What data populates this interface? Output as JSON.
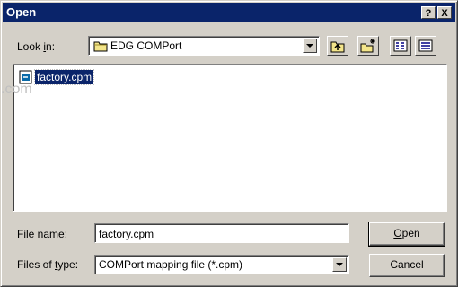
{
  "window": {
    "title": "Open",
    "help_glyph": "?",
    "close_glyph": "X"
  },
  "look_in": {
    "label_pre": "Look ",
    "label_key": "i",
    "label_post": "n:",
    "value": "EDG COMPort",
    "icon": "folder-icon"
  },
  "toolbar": {
    "buttons": [
      {
        "name": "up-one-level-icon"
      },
      {
        "name": "new-folder-icon"
      },
      {
        "name": "list-view-icon"
      },
      {
        "name": "details-view-icon"
      }
    ]
  },
  "files": [
    {
      "name": "factory.cpm",
      "icon": "cpm-file-icon",
      "selected": true
    }
  ],
  "watermark": ".com",
  "file_name": {
    "label_pre": "File ",
    "label_key": "n",
    "label_post": "ame:",
    "value": "factory.cpm"
  },
  "file_type": {
    "label_pre": "Files of ",
    "label_key": "t",
    "label_post": "ype:",
    "value": "COMPort mapping file (*.cpm)"
  },
  "buttons": {
    "open_key": "O",
    "open_rest": "pen",
    "cancel": "Cancel"
  },
  "colors": {
    "titlebar": "#0a246a",
    "face": "#d4d0c8",
    "selection": "#0a246a"
  }
}
